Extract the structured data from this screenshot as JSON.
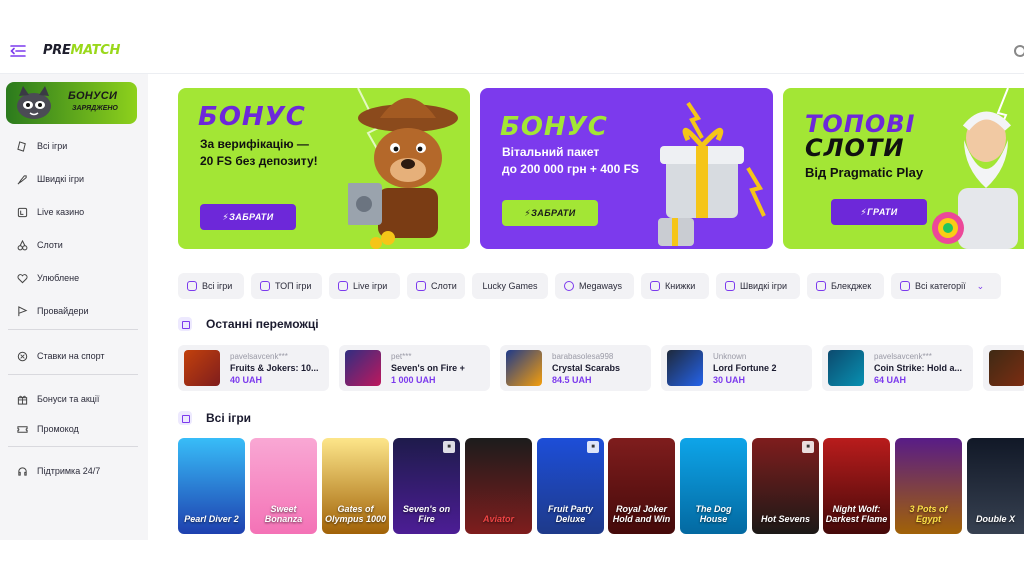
{
  "header": {
    "logo_main": "PRE",
    "logo_accent": "MATCH"
  },
  "sidebar": {
    "bonus_title": "БОНУСИ",
    "bonus_subtitle": "ЗАРЯДЖЕНО",
    "items": [
      {
        "label": "Всі ігри",
        "icon": "dice-icon"
      },
      {
        "label": "Швидкі ігри",
        "icon": "rocket-icon"
      },
      {
        "label": "Live казино",
        "icon": "live-cards-icon"
      },
      {
        "label": "Слоти",
        "icon": "cherries-icon"
      },
      {
        "label": "Улюблене",
        "icon": "heart-icon"
      },
      {
        "label": "Провайдери",
        "icon": "flag-icon"
      },
      {
        "label": "Ставки на спорт",
        "icon": "soccer-ball-icon"
      },
      {
        "label": "Бонуси та акції",
        "icon": "gift-icon"
      },
      {
        "label": "Промокод",
        "icon": "ticket-icon"
      },
      {
        "label": "Підтримка 24/7",
        "icon": "headset-icon"
      }
    ]
  },
  "banners": [
    {
      "title": "БОНУС",
      "line1": "За верифікацію —",
      "line2": "20 FS без депозиту!",
      "button": "⚡ЗАБРАТИ"
    },
    {
      "title": "БОНУС",
      "line1": "Вітальний пакет",
      "line2": "до 200 000 грн + 400 FS",
      "button": "⚡ЗАБРАТИ"
    },
    {
      "title_line1": "ТОПОВІ",
      "title_line2": "СЛОТИ",
      "line1": "Від Pragmatic Play",
      "button": "⚡ГРАТИ"
    }
  ],
  "chips": [
    "Всі ігри",
    "ТОП ігри",
    "Live ігри",
    "Слоти",
    "Lucky Games",
    "Megaways",
    "Книжки",
    "Швидкі ігри",
    "Блекджек",
    "Всі категорії"
  ],
  "recent_winners": {
    "title": "Останні переможці",
    "items": [
      {
        "user": "pavelsavcenk***",
        "game": "Fruits & Jokers: 10...",
        "amount": "40 UAH"
      },
      {
        "user": "pet***",
        "game": "Seven's on Fire +",
        "amount": "1 000 UAH"
      },
      {
        "user": "barabasolesa998",
        "game": "Crystal Scarabs",
        "amount": "84.5 UAH"
      },
      {
        "user": "Unknown",
        "game": "Lord Fortune 2",
        "amount": "30 UAH"
      },
      {
        "user": "pavelsavcenk***",
        "game": "Coin Strike: Hold a...",
        "amount": "64 UAH"
      }
    ]
  },
  "all_games": {
    "title": "Всі ігри",
    "items": [
      {
        "name": "Pearl Diver 2"
      },
      {
        "name": "Sweet Bonanza"
      },
      {
        "name": "Gates of Olympus 1000"
      },
      {
        "name": "Seven's on Fire"
      },
      {
        "name": "Aviator"
      },
      {
        "name": "Fruit Party Deluxe"
      },
      {
        "name": "Royal Joker Hold and Win"
      },
      {
        "name": "The Dog House"
      },
      {
        "name": "Hot Sevens"
      },
      {
        "name": "Night Wolf: Darkest Flame"
      },
      {
        "name": "3 Pots of Egypt"
      },
      {
        "name": "Double X"
      }
    ]
  },
  "colors": {
    "accent_purple": "#7c3aed",
    "accent_lime": "#a3e635"
  }
}
